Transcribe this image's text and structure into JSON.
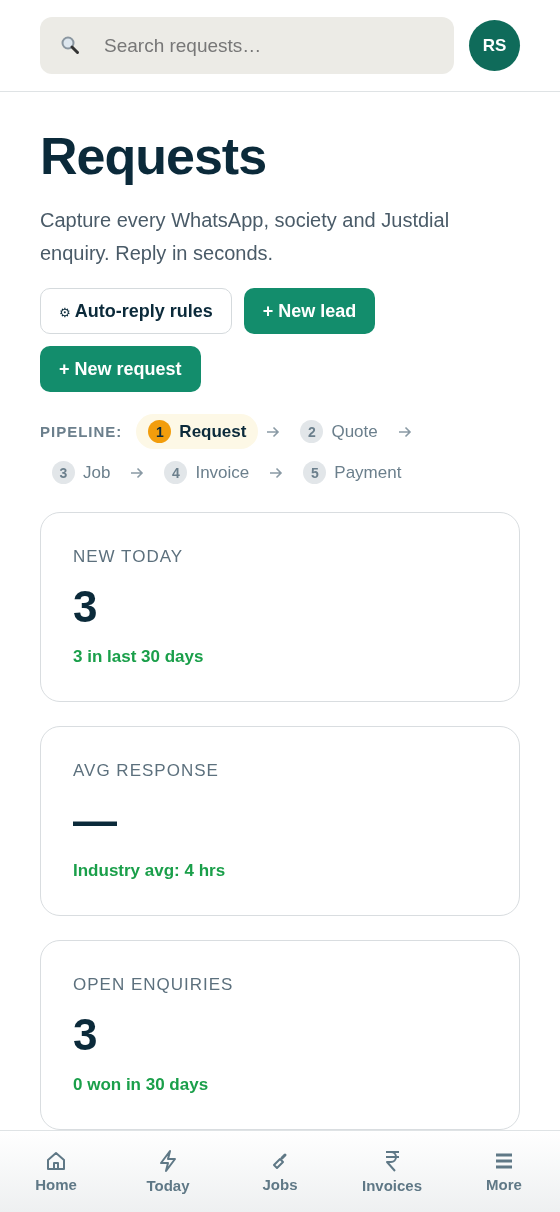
{
  "search": {
    "placeholder": "Search requests…"
  },
  "avatar": {
    "initials": "RS"
  },
  "title": "Requests",
  "subtitle": "Capture every WhatsApp, society and Justdial enquiry. Reply in seconds.",
  "actions": [
    {
      "label": "Auto-reply rules",
      "kind": "secondary",
      "icon": "⚙"
    },
    {
      "label": "+ New lead",
      "kind": "primary"
    },
    {
      "label": "+ New request",
      "kind": "primary"
    }
  ],
  "pipeline": {
    "label": "PIPELINE:",
    "steps": [
      {
        "number": "1",
        "label": "Request",
        "selected": true
      },
      {
        "number": "2",
        "label": "Quote",
        "selected": false
      },
      {
        "number": "3",
        "label": "Job",
        "selected": false
      },
      {
        "number": "4",
        "label": "Invoice",
        "selected": false
      },
      {
        "number": "5",
        "label": "Payment",
        "selected": false
      }
    ]
  },
  "stats": [
    {
      "label": "NEW TODAY",
      "value": "3",
      "note": "3 in last 30 days"
    },
    {
      "label": "AVG RESPONSE",
      "value": "—",
      "note": "Industry avg: 4 hrs"
    },
    {
      "label": "OPEN ENQUIRIES",
      "value": "3",
      "note": "0 won in 30 days"
    }
  ],
  "bottom_nav": [
    {
      "label": "Home",
      "kind": "home"
    },
    {
      "label": "Today",
      "kind": "today"
    },
    {
      "label": "Jobs",
      "kind": "jobs"
    },
    {
      "label": "Invoices",
      "kind": "invoices"
    },
    {
      "label": "More",
      "kind": "more"
    }
  ]
}
